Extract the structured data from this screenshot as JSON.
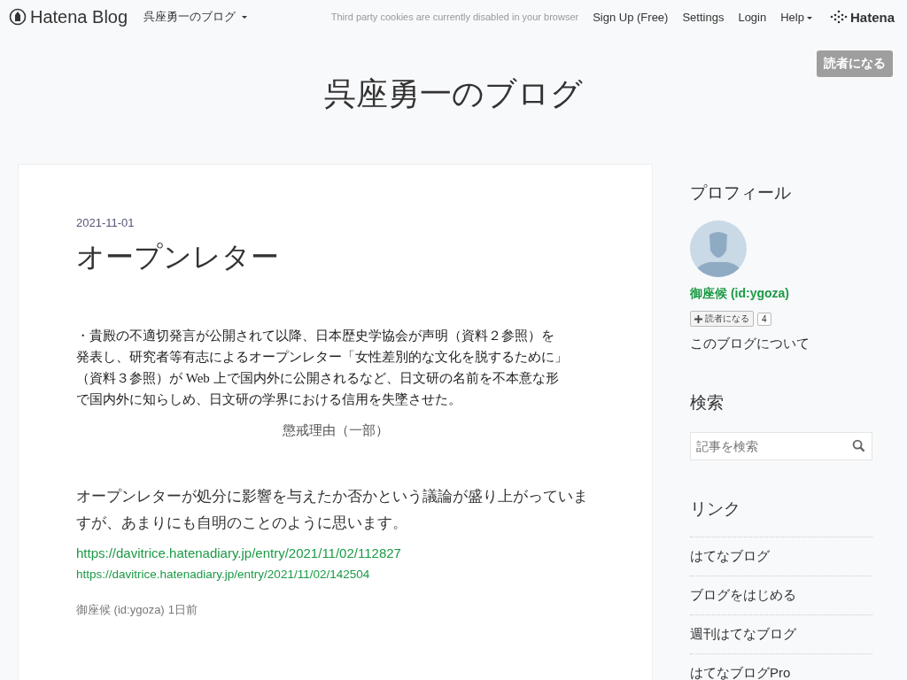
{
  "header": {
    "brand": "Hatena Blog",
    "blog_menu": "呉座勇一のブログ",
    "cookie_notice": "Third party cookies are currently disabled in your browser",
    "nav": [
      {
        "label": "Sign Up (Free)",
        "dropdown": false
      },
      {
        "label": "Settings",
        "dropdown": false
      },
      {
        "label": "Login",
        "dropdown": false
      },
      {
        "label": "Help",
        "dropdown": true
      }
    ],
    "hatena_logo": "Hatena"
  },
  "subscribe_button": "読者になる",
  "blog_title": "呉座勇一のブログ",
  "entry": {
    "date": "2021-11-01",
    "title": "オープンレター",
    "document_image": {
      "lines": [
        "・貴殿の不適切発言が公開されて以降、日本歴史学協会が声明（資料２参照）を",
        "発表し、研究者等有志によるオープンレター「女性差別的な文化を脱するために」",
        "（資料３参照）が Web 上で国内外に公開されるなど、日文研の名前を不本意な形",
        "で国内外に知らしめ、日文研の学界における信用を失墜させた。"
      ]
    },
    "caption": "懲戒理由（一部）",
    "paragraph": "オープンレターが処分に影響を与えたか否かという議論が盛り上がっていますが、あまりにも自明のことのように思います。",
    "links": [
      "https://davitrice.hatenadiary.jp/entry/2021/11/02/112827",
      "https://davitrice.hatenadiary.jp/entry/2021/11/02/142504"
    ],
    "footer": {
      "author": "御座候 (id:ygoza)",
      "time": "1日前"
    }
  },
  "sidebar": {
    "profile": {
      "heading": "プロフィール",
      "name": "御座候 (id:ygoza)",
      "subscribe_label": "読者になる",
      "count": "4",
      "about_link": "このブログについて"
    },
    "search": {
      "heading": "検索",
      "placeholder": "記事を検索"
    },
    "links": {
      "heading": "リンク",
      "items": [
        "はてなブログ",
        "ブログをはじめる",
        "週刊はてなブログ",
        "はてなブログPro"
      ]
    }
  }
}
